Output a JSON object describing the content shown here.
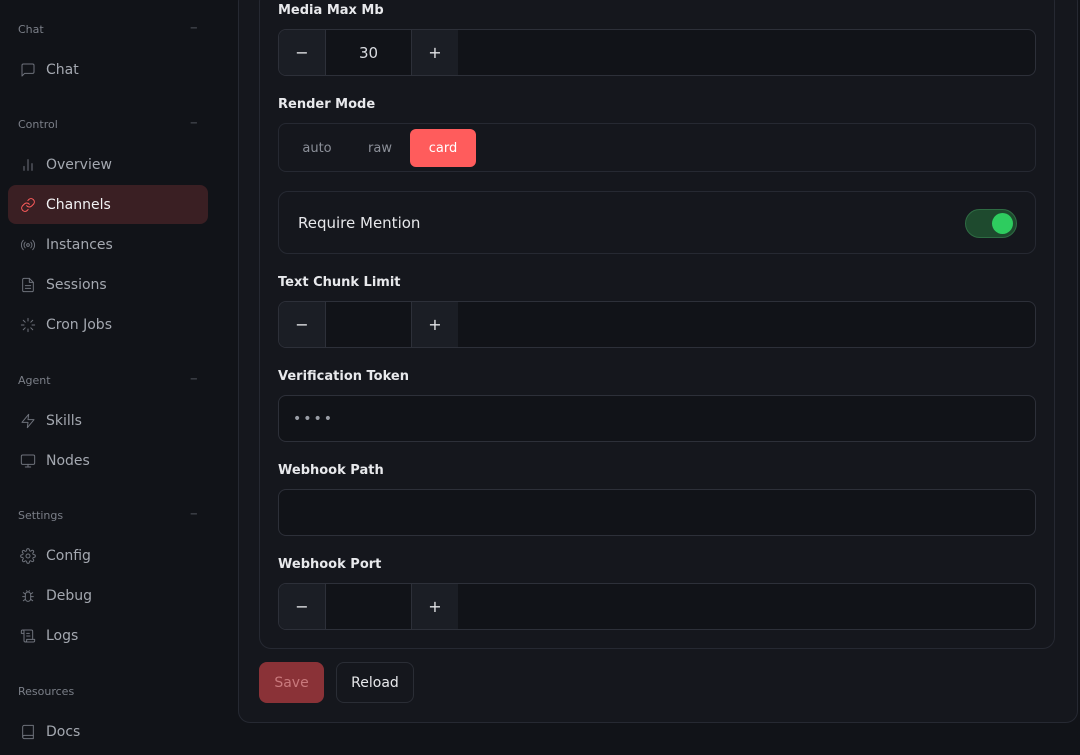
{
  "sidebar": {
    "groups": [
      {
        "label": "Chat",
        "collapse": "−"
      },
      {
        "label": "Control",
        "collapse": "−"
      },
      {
        "label": "Agent",
        "collapse": "−"
      },
      {
        "label": "Settings",
        "collapse": "−"
      },
      {
        "label": "Resources",
        "collapse": ""
      }
    ],
    "items": [
      {
        "label": "Chat",
        "icon": "message-square-icon"
      },
      {
        "label": "Overview",
        "icon": "bar-chart-icon"
      },
      {
        "label": "Channels",
        "icon": "link-icon",
        "active": true
      },
      {
        "label": "Instances",
        "icon": "radio-icon"
      },
      {
        "label": "Sessions",
        "icon": "file-text-icon"
      },
      {
        "label": "Cron Jobs",
        "icon": "loader-icon"
      },
      {
        "label": "Skills",
        "icon": "zap-icon"
      },
      {
        "label": "Nodes",
        "icon": "monitor-icon"
      },
      {
        "label": "Config",
        "icon": "gear-icon"
      },
      {
        "label": "Debug",
        "icon": "bug-icon"
      },
      {
        "label": "Logs",
        "icon": "scroll-icon"
      },
      {
        "label": "Docs",
        "icon": "book-icon"
      }
    ]
  },
  "form": {
    "media_max_mb": {
      "label": "Media Max Mb",
      "value": "30",
      "minus": "−",
      "plus": "+"
    },
    "render_mode": {
      "label": "Render Mode",
      "options": [
        "auto",
        "raw",
        "card"
      ],
      "selected": "card"
    },
    "require_mention": {
      "label": "Require Mention",
      "enabled": true
    },
    "text_chunk_limit": {
      "label": "Text Chunk Limit",
      "value": "",
      "minus": "−",
      "plus": "+"
    },
    "verification_token": {
      "label": "Verification Token",
      "value": "••••"
    },
    "webhook_path": {
      "label": "Webhook Path",
      "value": ""
    },
    "webhook_port": {
      "label": "Webhook Port",
      "value": "",
      "minus": "−",
      "plus": "+"
    }
  },
  "actions": {
    "save_label": "Save",
    "reload_label": "Reload"
  },
  "colors": {
    "accent": "#ff5c5c",
    "toggle_on": "#2ecc5f",
    "background": "#111318"
  }
}
